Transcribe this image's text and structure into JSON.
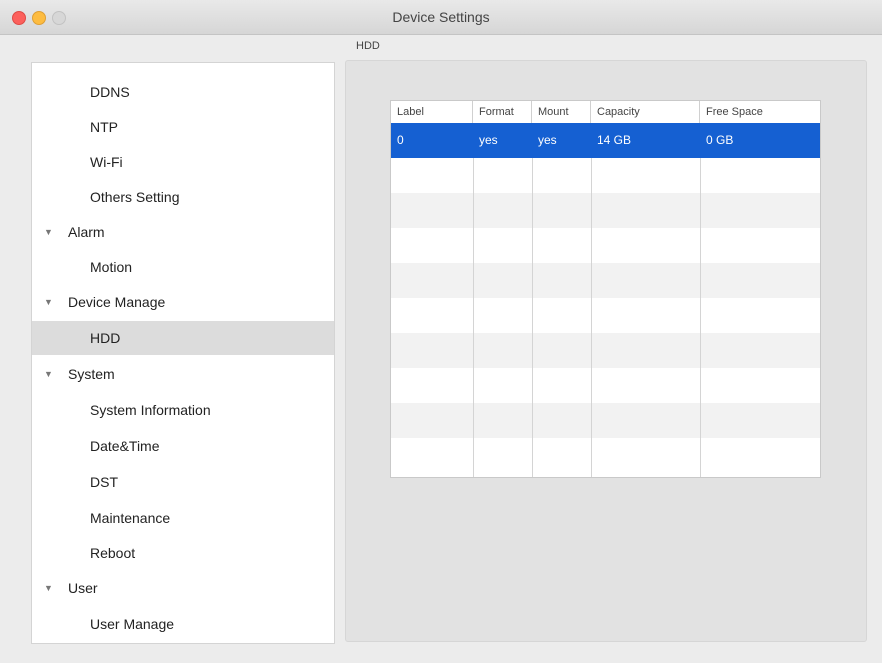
{
  "window": {
    "title": "Device Settings"
  },
  "sidebar": {
    "items": [
      {
        "label": "DDNS",
        "kind": "child"
      },
      {
        "label": "NTP",
        "kind": "child"
      },
      {
        "label": "Wi-Fi",
        "kind": "child"
      },
      {
        "label": "Others Setting",
        "kind": "child"
      },
      {
        "label": "Alarm",
        "kind": "group"
      },
      {
        "label": "Motion",
        "kind": "child"
      },
      {
        "label": "Device Manage",
        "kind": "group"
      },
      {
        "label": "HDD",
        "kind": "child",
        "selected": true
      },
      {
        "label": "System",
        "kind": "group"
      },
      {
        "label": "System Information",
        "kind": "child"
      },
      {
        "label": "Date&Time",
        "kind": "child"
      },
      {
        "label": "DST",
        "kind": "child"
      },
      {
        "label": "Maintenance",
        "kind": "child"
      },
      {
        "label": "Reboot",
        "kind": "child"
      },
      {
        "label": "User",
        "kind": "group"
      },
      {
        "label": "User Manage",
        "kind": "child"
      }
    ],
    "group_arrow": "▼"
  },
  "main": {
    "section_label": "HDD",
    "table": {
      "columns": [
        "Label",
        "Format",
        "Mount",
        "Capacity",
        "Free Space"
      ],
      "rows": [
        [
          "0",
          "yes",
          "yes",
          "14 GB",
          "0 GB"
        ]
      ]
    }
  },
  "colors": {
    "selection": "#1560d2",
    "accent_close": "#fc605c",
    "accent_min": "#fdbc40"
  }
}
